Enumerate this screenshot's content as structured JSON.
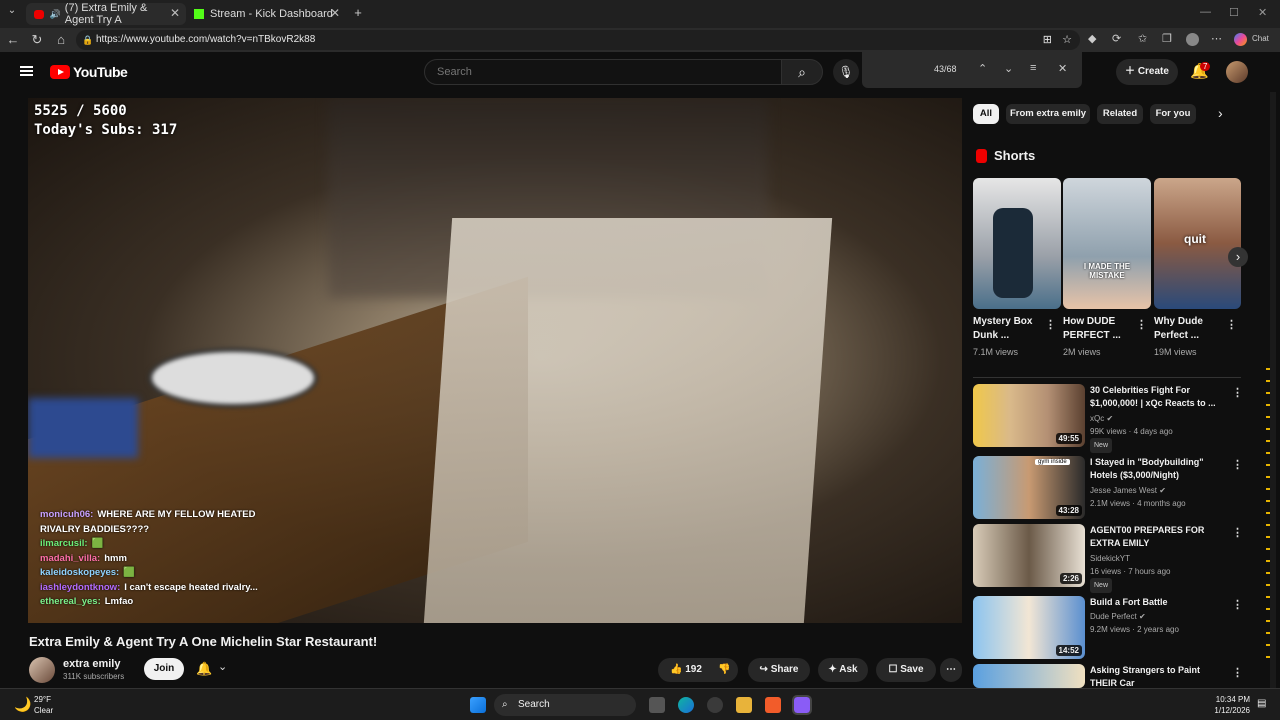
{
  "browser": {
    "tabs": [
      {
        "title": "(7) Extra Emily & Agent Try A",
        "active": true
      },
      {
        "title": "Stream - Kick Dashboard",
        "active": false
      }
    ],
    "url": "https://www.youtube.com/watch?v=nTBkovR2k88",
    "copilot_label": "Chat"
  },
  "header": {
    "logo_text": "YouTube",
    "search_placeholder": "Search",
    "find_count": "43/68",
    "create_label": "Create",
    "notifications": "7"
  },
  "video": {
    "overlay_counter": "5525 / 5600",
    "overlay_subs": "Today's Subs: 317",
    "chat": [
      {
        "user": "monicuh06:",
        "text": "WHERE ARE MY FELLOW HEATED RIVALRY BADDIES????",
        "color": "#c7a0ff"
      },
      {
        "user": "ilmarcusil:",
        "text": "🟩",
        "color": "#6cf07a"
      },
      {
        "user": "madahi_villa:",
        "text": "hmm",
        "color": "#ff6fa8"
      },
      {
        "user": "kaleidoskopeyes:",
        "text": "🟩",
        "color": "#8fd3ff"
      },
      {
        "user": "iashleydontknow:",
        "text": "I can't escape heated rivalry...",
        "color": "#b36bff"
      },
      {
        "user": "ethereal_yes:",
        "text": "Lmfao",
        "color": "#7cf08a"
      }
    ],
    "title": "Extra Emily & Agent Try A One Michelin Star Restaurant!",
    "channel": "extra emily",
    "subscribers": "311K subscribers",
    "join_label": "Join",
    "likes": "192",
    "share_label": "Share",
    "ask_label": "Ask",
    "save_label": "Save"
  },
  "chips": [
    "All",
    "From extra emily",
    "Related",
    "For you"
  ],
  "shorts": {
    "heading": "Shorts",
    "items": [
      {
        "title": "Mystery Box Dunk ...",
        "views": "7.1M views",
        "overlay": ""
      },
      {
        "title": "How DUDE PERFECT ...",
        "views": "2M views",
        "overlay": "I MADE THE MISTAKE"
      },
      {
        "title": "Why Dude Perfect ...",
        "views": "19M views",
        "overlay": "quit"
      }
    ]
  },
  "recommendations": [
    {
      "title": "30 Celebrities Fight For $1,000,000! | xQc Reacts to ...",
      "channel": "xQc",
      "meta": "99K views · 4 days ago",
      "badge": "New",
      "duration": "49:55"
    },
    {
      "title": "I Stayed in \"Bodybuilding\" Hotels ($3,000/Night)",
      "channel": "Jesse James West",
      "meta": "2.1M views · 4 months ago",
      "badge": "",
      "duration": "43:28"
    },
    {
      "title": "AGENT00 PREPARES FOR EXTRA EMILY",
      "channel": "SidekickYT",
      "meta": "16 views · 7 hours ago",
      "badge": "New",
      "duration": "2:26"
    },
    {
      "title": "Build a Fort Battle",
      "channel": "Dude Perfect",
      "meta": "9.2M views · 2 years ago",
      "badge": "",
      "duration": "14:52"
    },
    {
      "title": "Asking Strangers to Paint THEIR Car",
      "channel": "",
      "meta": "",
      "badge": "",
      "duration": ""
    }
  ],
  "taskbar": {
    "temp": "29°F",
    "condition": "Clear",
    "search_label": "Search",
    "time": "10:34 PM",
    "date": "1/12/2026"
  }
}
